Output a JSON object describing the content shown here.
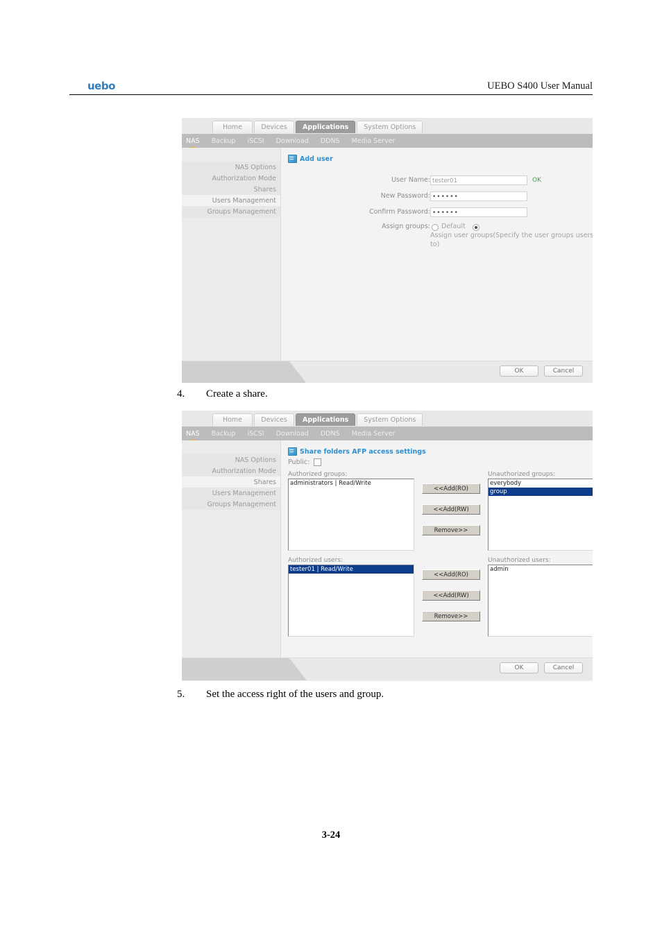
{
  "header": {
    "logo": "uebo",
    "manual_title": "UEBO S400 User Manual"
  },
  "page_number": "3-24",
  "steps": [
    {
      "num": "4.",
      "text": "Create a share."
    },
    {
      "num": "5.",
      "text": "Set the access right of the users and group."
    }
  ],
  "figure1": {
    "tabs": [
      {
        "label": "Home",
        "active": false
      },
      {
        "label": "Devices",
        "active": false
      },
      {
        "label": "Applications",
        "active": true
      },
      {
        "label": "System Options",
        "active": false
      }
    ],
    "subnav": [
      {
        "label": "NAS",
        "active": true
      },
      {
        "label": "Backup",
        "active": false
      },
      {
        "label": "iSCSI",
        "active": false
      },
      {
        "label": "Download",
        "active": false
      },
      {
        "label": "DDNS",
        "active": false
      },
      {
        "label": "Media Server",
        "active": false
      }
    ],
    "sidebar": [
      {
        "label": "NAS Options",
        "active": false
      },
      {
        "label": "Authorization Mode",
        "active": false
      },
      {
        "label": "Shares",
        "active": false
      },
      {
        "label": "Users Management",
        "active": true
      },
      {
        "label": "Groups Management",
        "active": false
      }
    ],
    "panel_title": "Add user",
    "panel_icon": "add-user-icon",
    "form": {
      "username_label": "User Name:",
      "username_value": "tester01",
      "username_status": "OK",
      "new_password_label": "New Password:",
      "new_password_value": "••••••",
      "confirm_password_label": "Confirm Password:",
      "confirm_password_value": "••••••",
      "assign_groups_label": "Assign groups:",
      "radio_default": "Default",
      "radio_assign": "Assign user groups(Specify the user groups users belong to)",
      "radio_selected": "assign"
    },
    "buttons": {
      "ok": "OK",
      "cancel": "Cancel"
    }
  },
  "figure2": {
    "tabs": [
      {
        "label": "Home",
        "active": false
      },
      {
        "label": "Devices",
        "active": false
      },
      {
        "label": "Applications",
        "active": true
      },
      {
        "label": "System Options",
        "active": false
      }
    ],
    "subnav": [
      {
        "label": "NAS",
        "active": true
      },
      {
        "label": "Backup",
        "active": false
      },
      {
        "label": "iSCSI",
        "active": false
      },
      {
        "label": "Download",
        "active": false
      },
      {
        "label": "DDNS",
        "active": false
      },
      {
        "label": "Media Server",
        "active": false
      }
    ],
    "sidebar": [
      {
        "label": "NAS Options",
        "active": false
      },
      {
        "label": "Authorization Mode",
        "active": false
      },
      {
        "label": "Shares",
        "active": true
      },
      {
        "label": "Users Management",
        "active": false
      },
      {
        "label": "Groups Management",
        "active": false
      }
    ],
    "panel_title": "Share folders AFP access settings",
    "panel_icon": "share-folder-icon",
    "public_label": "Public:",
    "public_checked": false,
    "groups": {
      "left_label": "Authorized groups:",
      "right_label": "Unauthorized groups:",
      "authorized": [
        {
          "label": "administrators | Read/Write",
          "selected": false
        }
      ],
      "unauthorized": [
        {
          "label": "everybody",
          "selected": false
        },
        {
          "label": "group",
          "selected": true
        }
      ],
      "btn_add_ro": "<<Add(RO)",
      "btn_add_rw": "<<Add(RW)",
      "btn_remove": "Remove>>"
    },
    "users": {
      "left_label": "Authorized users:",
      "right_label": "Unauthorized users:",
      "authorized": [
        {
          "label": "tester01 | Read/Write",
          "selected": true
        }
      ],
      "unauthorized": [
        {
          "label": "admin",
          "selected": false
        }
      ],
      "btn_add_ro": "<<Add(RO)",
      "btn_add_rw": "<<Add(RW)",
      "btn_remove": "Remove>>"
    },
    "buttons": {
      "ok": "OK",
      "cancel": "Cancel"
    }
  }
}
